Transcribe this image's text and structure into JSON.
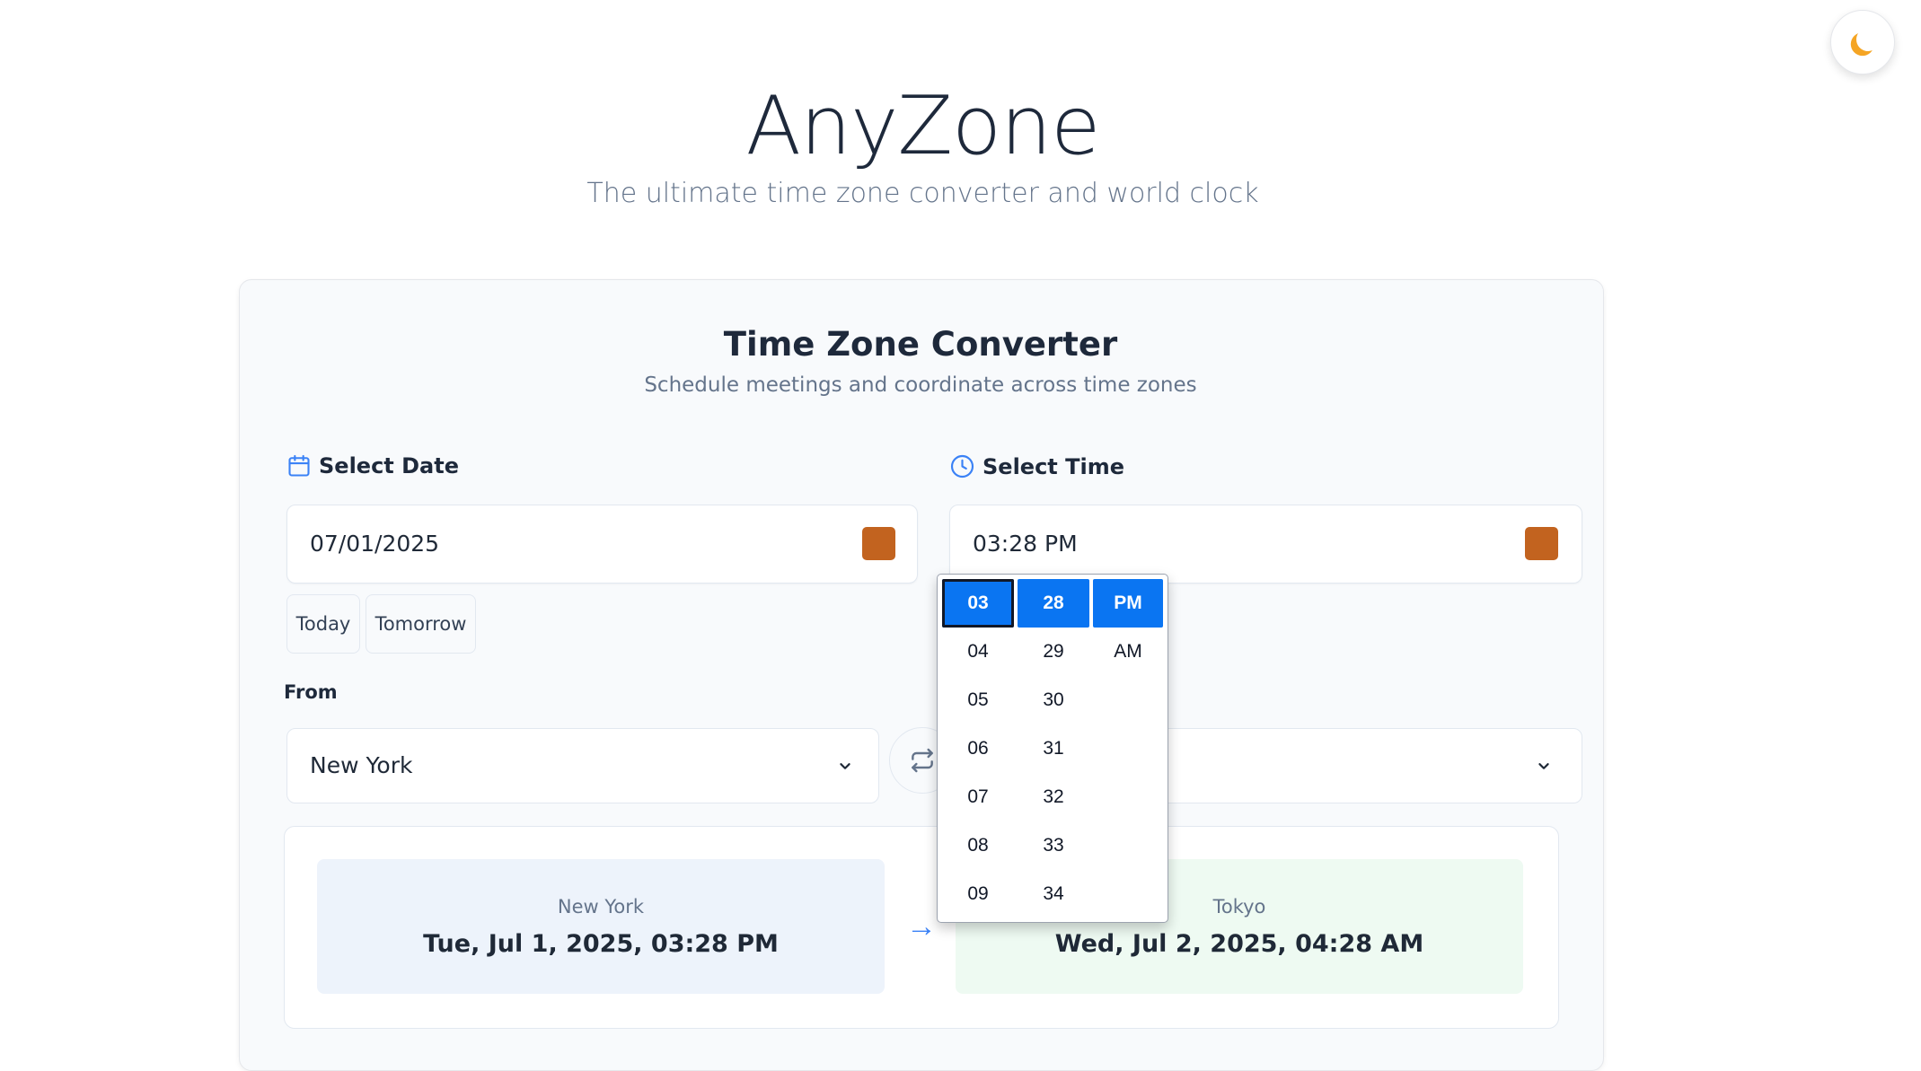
{
  "app": {
    "title": "AnyZone",
    "subtitle": "The ultimate time zone converter and world clock",
    "theme_icon": "moon-icon"
  },
  "converter": {
    "title": "Time Zone Converter",
    "subtitle": "Schedule meetings and coordinate across time zones",
    "date": {
      "label": "Select Date",
      "icon": "calendar-icon",
      "value": "07/01/2025",
      "quick": [
        "Today",
        "Tomorrow"
      ]
    },
    "time": {
      "label": "Select Time",
      "icon": "clock-icon",
      "value": "03:28 PM"
    },
    "from": {
      "label": "From",
      "value": "New York"
    },
    "to": {
      "value": ""
    },
    "result": {
      "from_city": "New York",
      "from_time": "Tue, Jul 1, 2025, 03:28 PM",
      "to_city": "Tokyo",
      "to_time": "Wed, Jul 2, 2025, 04:28 AM",
      "arrow": "→"
    }
  },
  "time_picker": {
    "hours": [
      "03",
      "04",
      "05",
      "06",
      "07",
      "08",
      "09"
    ],
    "minutes": [
      "28",
      "29",
      "30",
      "31",
      "32",
      "33",
      "34"
    ],
    "periods": [
      "PM",
      "AM"
    ],
    "selected": {
      "hour": "03",
      "minute": "28",
      "period": "PM"
    },
    "accent": "#0a75f2"
  },
  "colors": {
    "picker_button": "#c2631f",
    "accent": "#3b82f6",
    "from_card_bg": "#edf3fb",
    "to_card_bg": "#eefaf2"
  }
}
